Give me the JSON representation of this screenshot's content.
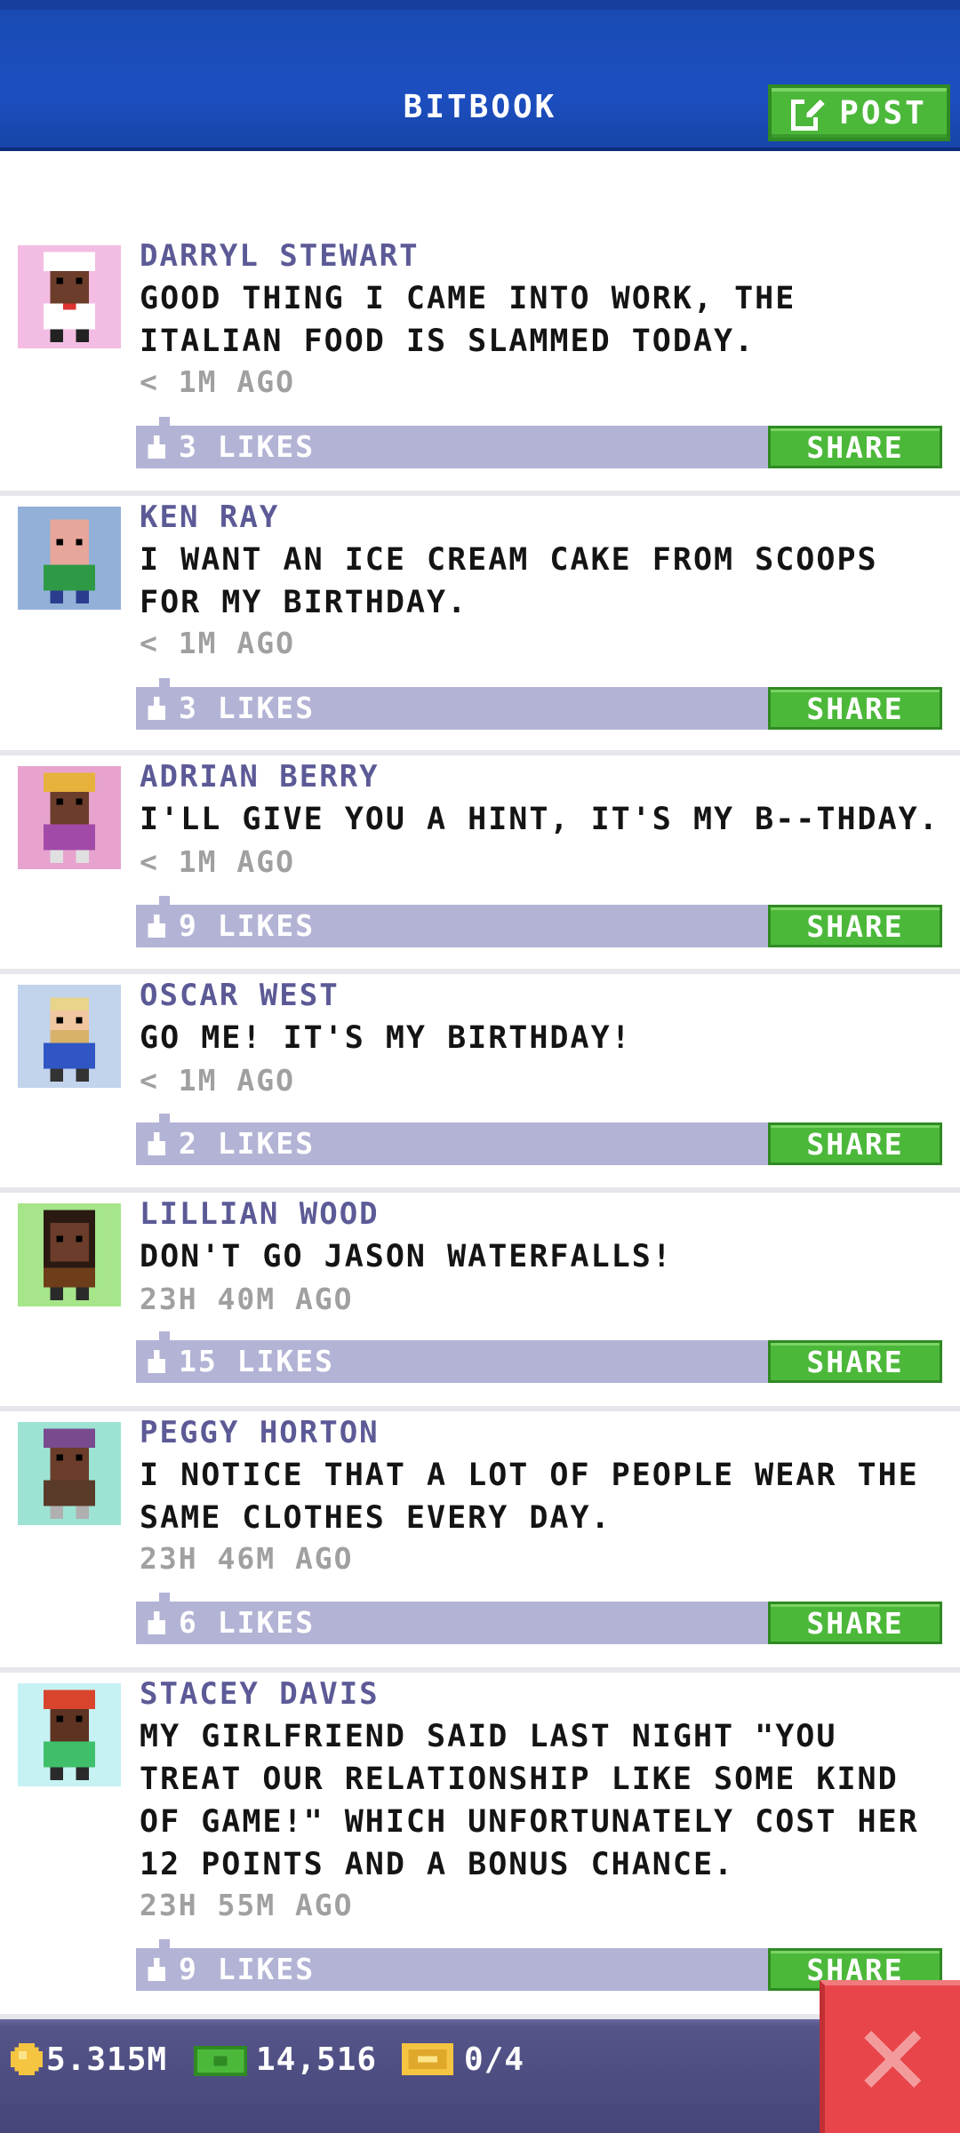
{
  "header": {
    "title": "BITBOOK",
    "post_label": "POST"
  },
  "colors": {
    "header_blue": "#1c4ec0",
    "name_purple": "#5c5a96",
    "like_bar": "#b3b3d6",
    "share_green": "#4cb83a",
    "close_red": "#e8454a"
  },
  "posts": [
    {
      "name": "DARRYL STEWART",
      "text": "GOOD THING I CAME INTO WORK, THE ITALIAN FOOD IS SLAMMED TODAY.",
      "time": "< 1M AGO",
      "likes": "3 LIKES",
      "share": "SHARE",
      "avatar_icon": "chef-avatar-icon"
    },
    {
      "name": "KEN RAY",
      "text": "I WANT AN ICE CREAM CAKE FROM SCOOPS FOR MY BIRTHDAY.",
      "time": "< 1M AGO",
      "likes": "3 LIKES",
      "share": "SHARE",
      "avatar_icon": "bald-man-avatar-icon"
    },
    {
      "name": "ADRIAN BERRY",
      "text": "I'LL GIVE YOU A HINT, IT'S MY B--THDAY.",
      "time": "< 1M AGO",
      "likes": "9 LIKES",
      "share": "SHARE",
      "avatar_icon": "blonde-person-avatar-icon"
    },
    {
      "name": "OSCAR WEST",
      "text": "GO ME! IT'S MY BIRTHDAY!",
      "time": "< 1M AGO",
      "likes": "2 LIKES",
      "share": "SHARE",
      "avatar_icon": "bearded-man-avatar-icon"
    },
    {
      "name": "LILLIAN WOOD",
      "text": "DON'T GO JASON WATERFALLS!",
      "time": "23H 40M AGO",
      "likes": "15 LIKES",
      "share": "SHARE",
      "avatar_icon": "woman-avatar-icon"
    },
    {
      "name": "PEGGY HORTON",
      "text": "I NOTICE THAT A LOT OF PEOPLE WEAR THE SAME CLOTHES EVERY DAY.",
      "time": "23H 46M AGO",
      "likes": "6 LIKES",
      "share": "SHARE",
      "avatar_icon": "purple-hair-avatar-icon"
    },
    {
      "name": "STACEY DAVIS",
      "text": "MY GIRLFRIEND SAID LAST NIGHT \"YOU TREAT OUR RELATIONSHIP LIKE SOME KIND OF GAME!\" WHICH UNFORTUNATELY COST HER 12 POINTS AND A BONUS CHANCE.",
      "time": "23H 55M AGO",
      "likes": "9 LIKES",
      "share": "SHARE",
      "avatar_icon": "red-hair-avatar-icon"
    }
  ],
  "status": {
    "coins": "5.315M",
    "bux": "14,516",
    "tickets": "0/4"
  }
}
